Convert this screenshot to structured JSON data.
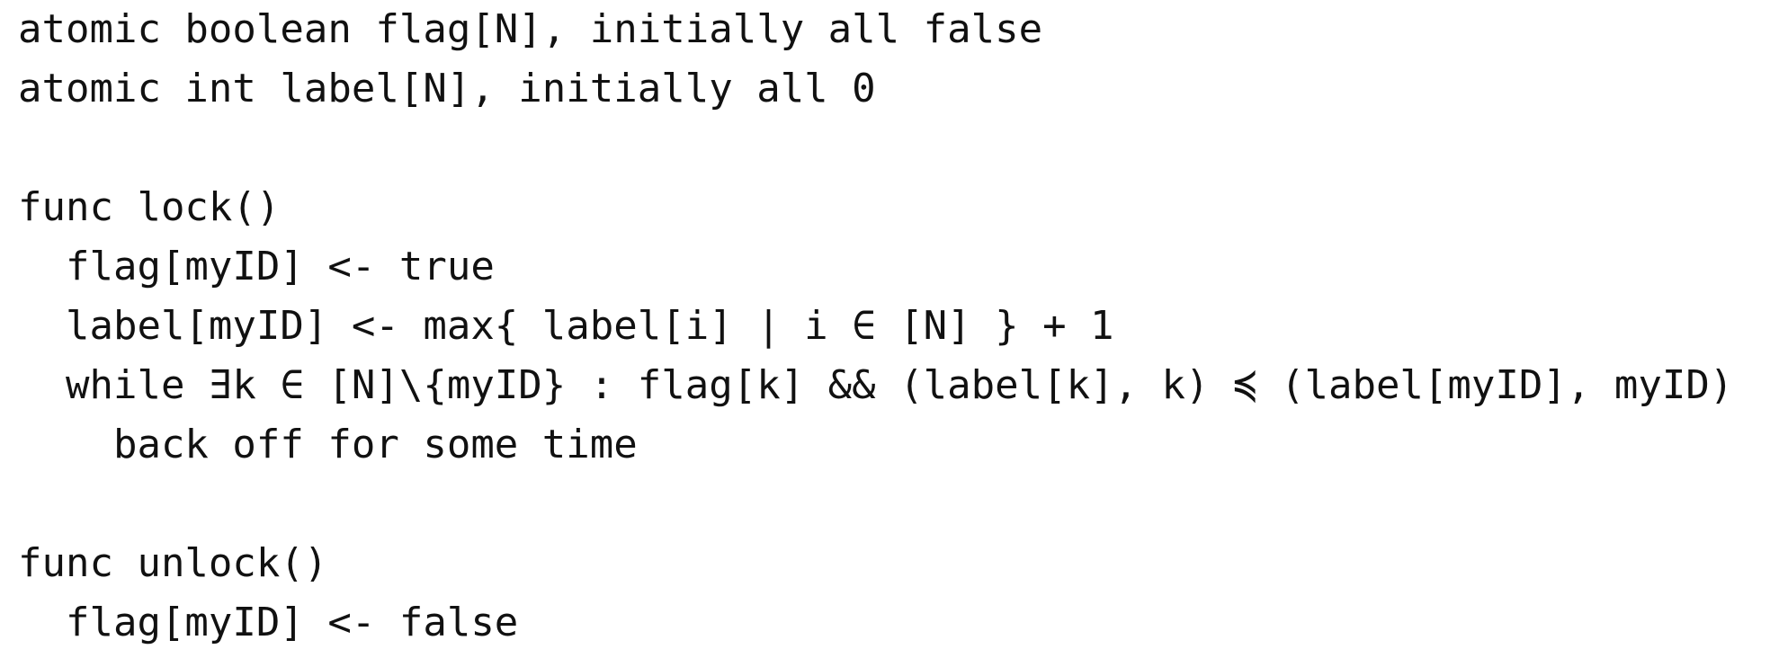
{
  "code": {
    "lines": [
      "atomic boolean flag[N], initially all false",
      "atomic int label[N], initially all 0",
      "",
      "func lock()",
      "  flag[myID] <- true",
      "  label[myID] <- max{ label[i] | i ∈ [N] } + 1",
      "  while ∃k ∈ [N]\\{myID} : flag[k] && (label[k], k) ≼ (label[myID], myID)",
      "    back off for some time",
      "",
      "func unlock()",
      "  flag[myID] <- false"
    ]
  }
}
